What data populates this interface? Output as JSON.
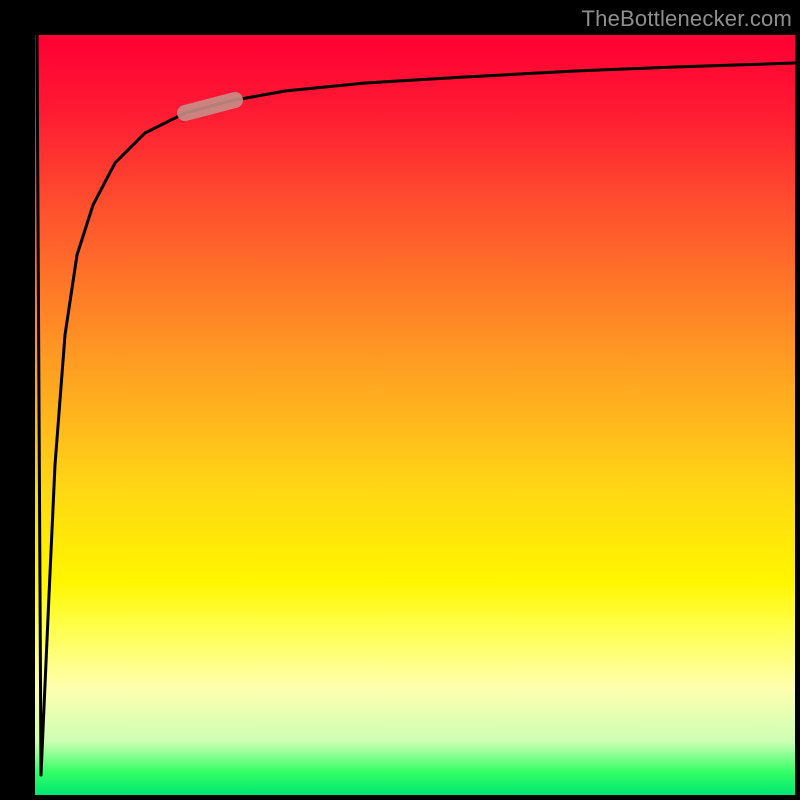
{
  "watermark": {
    "text": "TheBottlenecker.com"
  },
  "colors": {
    "frame": "#000000",
    "curve": "#000000",
    "highlight_stroke": "#c78e86",
    "gradient_stops": [
      "#ff0033",
      "#ff1a33",
      "#ff4d2e",
      "#ff7f27",
      "#ffae1f",
      "#ffd814",
      "#fff600",
      "#ffff4d",
      "#ffffb0",
      "#ccffb3",
      "#33ff66",
      "#00e673"
    ]
  },
  "chart_data": {
    "type": "line",
    "title": "",
    "xlabel": "",
    "ylabel": "",
    "xlim": [
      0,
      100
    ],
    "ylim": [
      0,
      100
    ],
    "grid": false,
    "legend": null,
    "series": [
      {
        "name": "bottleneck-curve",
        "x": [
          0,
          1,
          1.5,
          2,
          3,
          4,
          5,
          7,
          10,
          14,
          18,
          23,
          30,
          40,
          55,
          70,
          85,
          100
        ],
        "y": [
          100,
          0,
          20,
          40,
          60,
          70,
          76,
          82,
          87,
          89,
          90,
          91,
          92,
          93,
          94,
          95,
          95.5,
          96
        ]
      }
    ],
    "annotations": [
      {
        "name": "highlight-segment",
        "x_range": [
          18,
          26
        ],
        "y_range": [
          90,
          91.5
        ]
      }
    ]
  }
}
